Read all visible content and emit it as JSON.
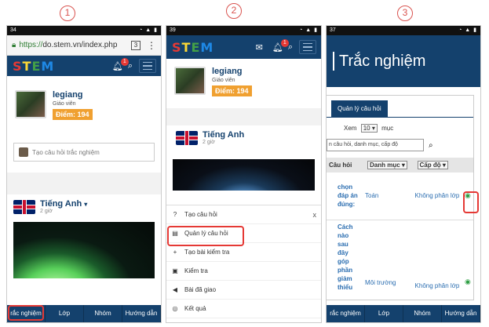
{
  "steps": [
    "1",
    "2",
    "3"
  ],
  "phone1": {
    "status_time": "34",
    "url_scheme": "https://",
    "url_rest": "do.stem.vn/index.php",
    "tab_count": "3",
    "logo": "STEM",
    "notif_count": "1",
    "user": {
      "name": "legiang",
      "role": "Giáo viên",
      "points_label": "Điểm:",
      "points_value": "194"
    },
    "ask_placeholder": "Tạo câu hỏi trắc nghiệm",
    "post": {
      "title": "Tiếng Anh",
      "time": "2 giờ"
    },
    "bottom_nav": [
      "rắc nghiệm",
      "Lớp",
      "Nhóm",
      "Hướng dẫn"
    ]
  },
  "phone2": {
    "status_time": "39",
    "logo": "STEM",
    "notif_count": "1",
    "user": {
      "name": "legiang",
      "role": "Giáo viên",
      "points_label": "Điểm:",
      "points_value": "194"
    },
    "post": {
      "title": "Tiếng Anh",
      "time": "2 giờ"
    },
    "menu": [
      {
        "icon": "question-circle-icon",
        "glyph": "?",
        "label": "Tạo câu hỏi"
      },
      {
        "icon": "book-icon",
        "glyph": "▤",
        "label": "Quản lý câu hỏi"
      },
      {
        "icon": "plus-circle-icon",
        "glyph": "+",
        "label": "Tạo bài kiểm tra"
      },
      {
        "icon": "briefcase-icon",
        "glyph": "▣",
        "label": "Kiểm tra"
      },
      {
        "icon": "bullhorn-icon",
        "glyph": "◀",
        "label": "Bài đã giao"
      },
      {
        "icon": "target-icon",
        "glyph": "◎",
        "label": "Kết quả"
      }
    ],
    "menu_close": "x"
  },
  "phone3": {
    "status_time": "37",
    "page_title": "Trắc nghiệm",
    "tab": "Quản lý câu hỏi",
    "show_prefix": "Xem",
    "show_value": "10",
    "show_suffix": "mục",
    "search_placeholder": "n câu hỏi, danh mục, cấp độ",
    "columns": [
      "Câu hỏi",
      "Danh mục",
      "Cấp độ"
    ],
    "rows": [
      {
        "question": "chọn đáp án đúng:",
        "category": "Toán",
        "level": "Không phân lớp"
      },
      {
        "question": "Cách nào sau đây góp phần giảm thiểu",
        "category": "Môi trường",
        "level": "Không phân lớp"
      }
    ],
    "bottom_nav": [
      "rắc nghiệm",
      "Lớp",
      "Nhóm",
      "Hướng dẫn"
    ]
  },
  "colors": {
    "navy": "#14416d",
    "highlight": "#e53935",
    "points": "#f0a030",
    "eye": "#2e9e44"
  }
}
